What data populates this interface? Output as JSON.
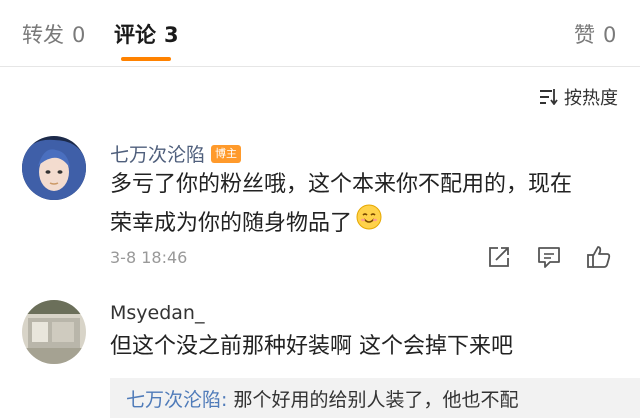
{
  "tabs": [
    {
      "label": "转发",
      "count": "0"
    },
    {
      "label": "评论",
      "count": "3"
    },
    {
      "label": "赞",
      "count": "0"
    }
  ],
  "sort": {
    "label": "按热度",
    "icon": "sort-icon"
  },
  "comments": [
    {
      "username": "七万次沦陷",
      "badge": "博主",
      "line1": "多亏了你的粉丝哦，这个本来你不配用的，现在",
      "line2": "荣幸成为你的随身物品了",
      "time": "3-8 18:46"
    },
    {
      "username": "Msyedan_",
      "line1": "但这个没之前那种好装啊 这个会掉下来吧"
    }
  ],
  "reply": {
    "name": "七万次沦陷:",
    "text": " 那个好用的给别人装了，他也不配"
  },
  "colors": {
    "accent": "#ff8200",
    "username": "#4f5f7c",
    "badge": "#ff9a2b"
  }
}
